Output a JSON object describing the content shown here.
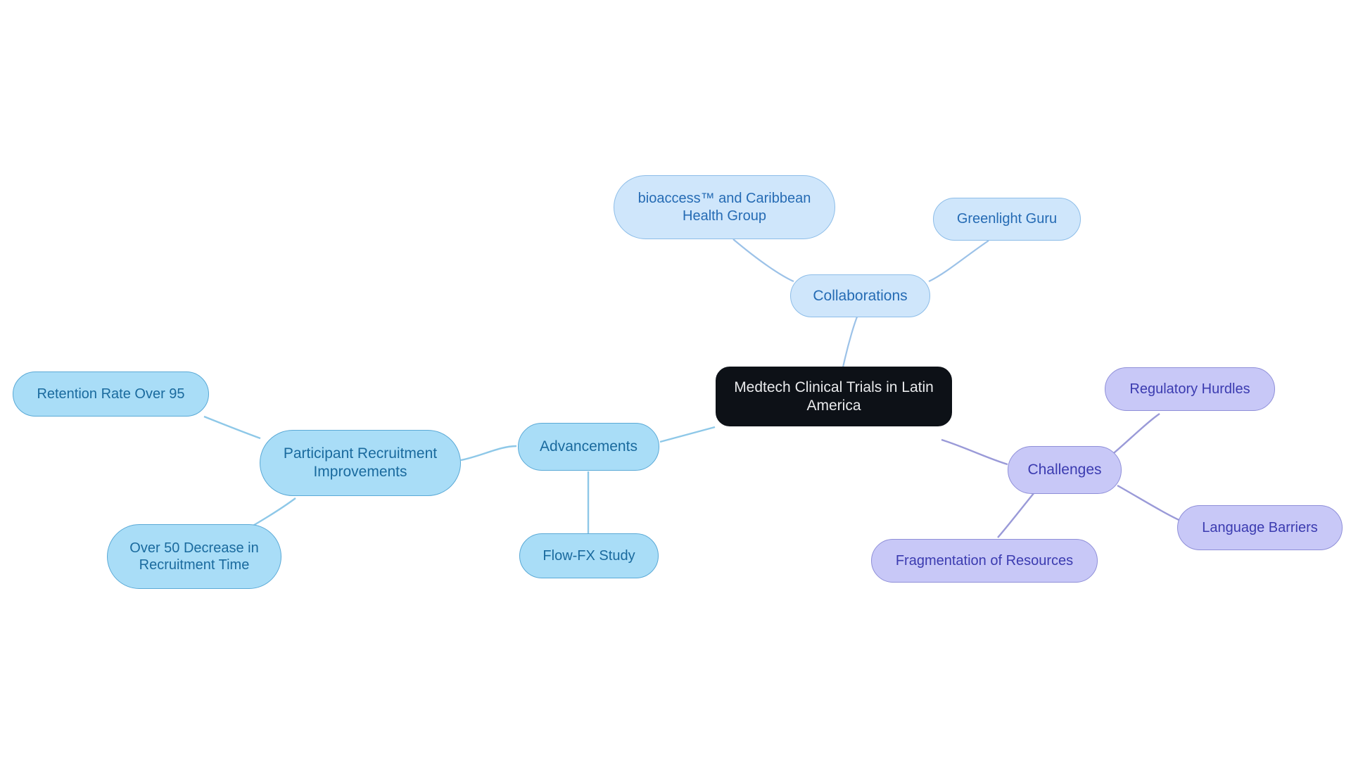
{
  "diagram": {
    "type": "mindmap",
    "title": "Medtech Clinical Trials in Latin America",
    "background": "#ffffff",
    "palette": {
      "root_fill": "#0d1117",
      "root_text": "#e9eaec",
      "blue_fill": "#a9ddf7",
      "blue_border": "#5aa9d6",
      "blue_text": "#1a6a9e",
      "lightblue_fill": "#cfe6fb",
      "lightblue_border": "#8dbde8",
      "lightblue_text": "#256bb4",
      "purple_fill": "#c8c8f7",
      "purple_border": "#8f8fd8",
      "purple_text": "#3b3bb0",
      "edge_blue": "#8ec8e8",
      "edge_lightblue": "#9cc2e8",
      "edge_purple": "#9a9ad8"
    }
  },
  "nodes": {
    "root": {
      "label": "Medtech Clinical Trials in Latin\nAmerica"
    },
    "collaborations": {
      "label": "Collaborations"
    },
    "bioaccess": {
      "label": "bioaccess™ and Caribbean\nHealth Group"
    },
    "greenlight": {
      "label": "Greenlight Guru"
    },
    "advancements": {
      "label": "Advancements"
    },
    "participant_recruitment": {
      "label": "Participant Recruitment\nImprovements"
    },
    "retention_rate": {
      "label": "Retention Rate Over 95"
    },
    "recruitment_time": {
      "label": "Over 50 Decrease in\nRecruitment Time"
    },
    "flow_fx": {
      "label": "Flow-FX Study"
    },
    "challenges": {
      "label": "Challenges"
    },
    "regulatory": {
      "label": "Regulatory Hurdles"
    },
    "language": {
      "label": "Language Barriers"
    },
    "fragmentation": {
      "label": "Fragmentation of Resources"
    }
  }
}
